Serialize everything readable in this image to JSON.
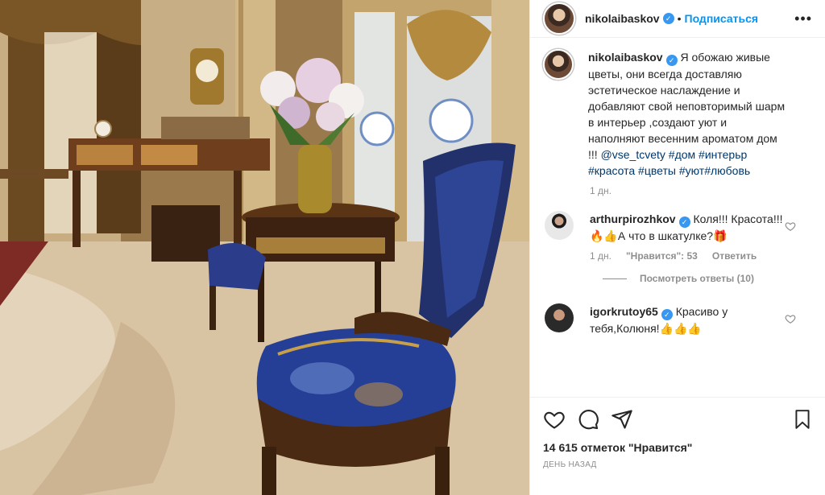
{
  "post": {
    "username": "nikolaibaskov",
    "follow_label": "Подписаться",
    "caption_user": "nikolaibaskov",
    "caption_text": "Я обожаю живые цветы, они всегда доставляю эстетическое наслаждение и добавляют свой неповторимый шарм в интерьер ,создают уют и наполняют весенним ароматом дом !!! ",
    "caption_tags": "@vse_tcvety #дом #интерьр #красота #цветы #уют#любовь",
    "caption_time": "1 дн."
  },
  "comments": [
    {
      "username": "arthurpirozhkov",
      "text": " Коля!!! Красота!!! 🔥👍А что в шкатулке?🎁",
      "time": "1 дн.",
      "likes": "\"Нравится\": 53",
      "reply_label": "Ответить",
      "view_replies": "Посмотреть ответы (10)"
    },
    {
      "username": "igorkrutoy65",
      "text": " Красиво у тебя,Колюня!👍👍👍"
    }
  ],
  "footer": {
    "likes_count": "14 615 отметок \"Нравится\"",
    "timestamp": "День назад"
  },
  "icons": {
    "like": "heart-icon",
    "comment": "comment-icon",
    "share": "share-icon",
    "save": "bookmark-icon",
    "more": "more-icon",
    "verified": "verified-icon"
  },
  "colors": {
    "link": "#0095f6",
    "hashtag": "#00376b",
    "muted": "#8e8e8e"
  }
}
